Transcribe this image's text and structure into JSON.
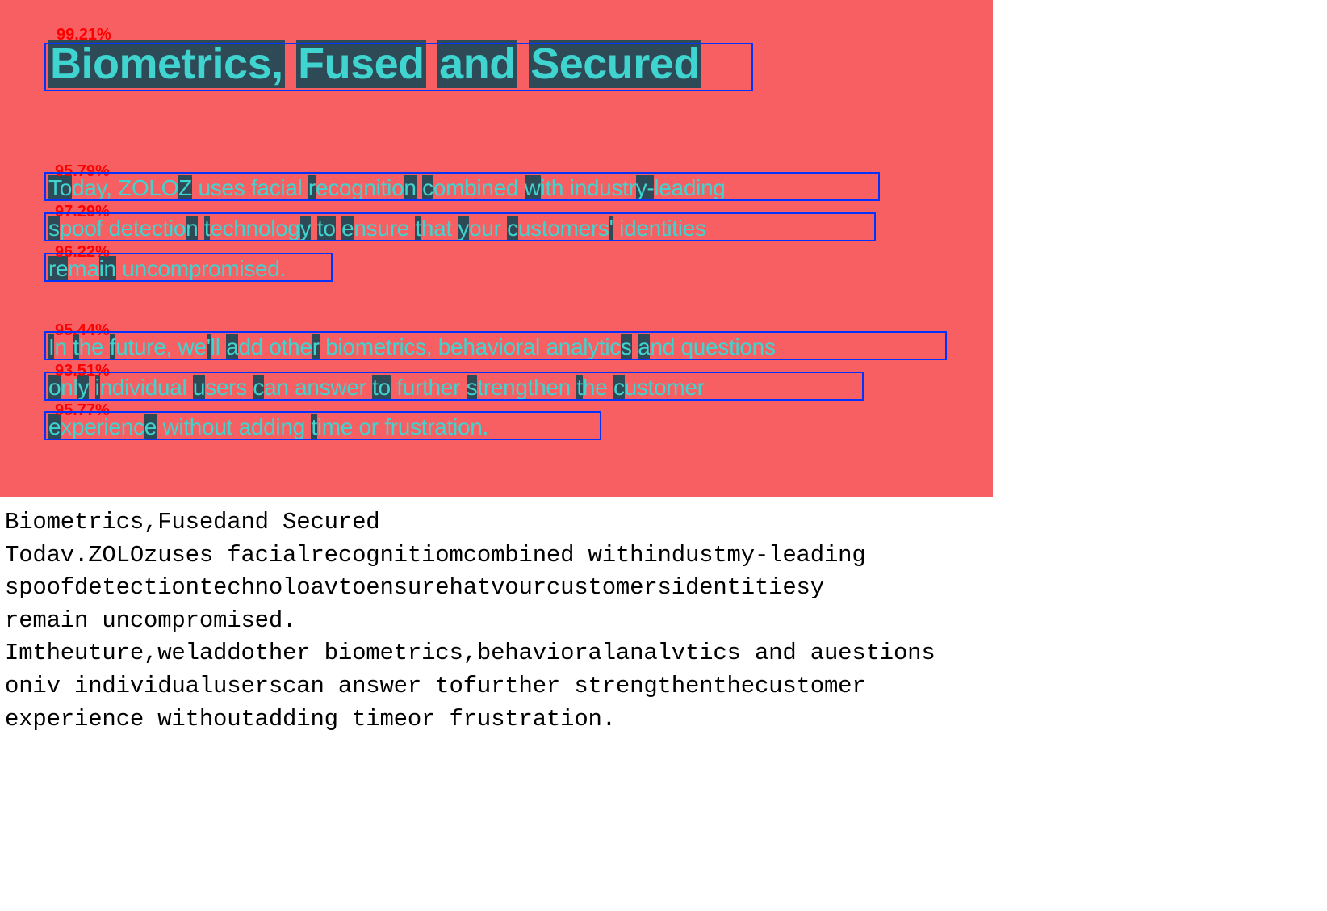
{
  "panel": {
    "heading": {
      "confidence": "99.21%",
      "words": [
        "Biometrics,",
        "Fused",
        "and",
        "Secured"
      ]
    },
    "para1": {
      "lines": [
        {
          "confidence": "95.79%",
          "text": "Today, ZOLOZ uses facial recognition combined with industry-leading"
        },
        {
          "confidence": "97.29%",
          "text": "spoof detection technology to ensure that your customers' identities"
        },
        {
          "confidence": "96.22%",
          "text": "remain uncompromised."
        }
      ]
    },
    "para2": {
      "lines": [
        {
          "confidence": "95.44%",
          "text": "In the future, we'll add other biometrics, behavioral analytics and questions"
        },
        {
          "confidence": "93.51%",
          "text": "only individual users can answer to further strengthen the customer"
        },
        {
          "confidence": "95.77%",
          "text": "experience without adding time or frustration."
        }
      ]
    }
  },
  "ocr_output": "Biometrics,Fusedand Secured\nTodav.ZOLOzuses facialrecognitiomcombined withindustmy-leading\nspoofdetectiontechnoloavtoensurehatvourcustomersidentitiesy\nremain uncompromised.\nImtheuture,weladdother biometrics,behavioralanalvtics and auestions\noniv individualuserscan answer tofurther strengthenthecustomer\nexperience withoutadding timeor frustration."
}
